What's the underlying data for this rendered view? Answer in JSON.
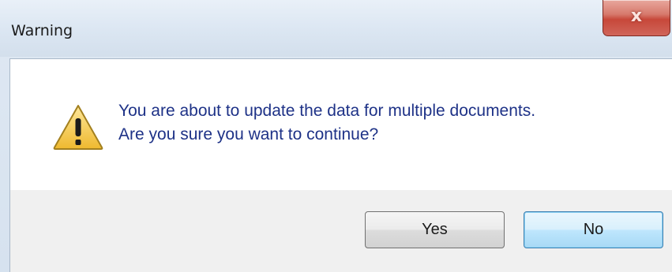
{
  "window": {
    "title": "Warning",
    "close_glyph": "x"
  },
  "message": {
    "icon": "warning-icon",
    "line1": "You are about to update the data for multiple documents.",
    "line2": "Are you sure you want to continue?"
  },
  "buttons": {
    "yes_label": "Yes",
    "no_label": "No"
  },
  "colors": {
    "message_text": "#1e3287",
    "icon_fill": "#f2c94c",
    "default_button_border": "#3c7fb1"
  }
}
